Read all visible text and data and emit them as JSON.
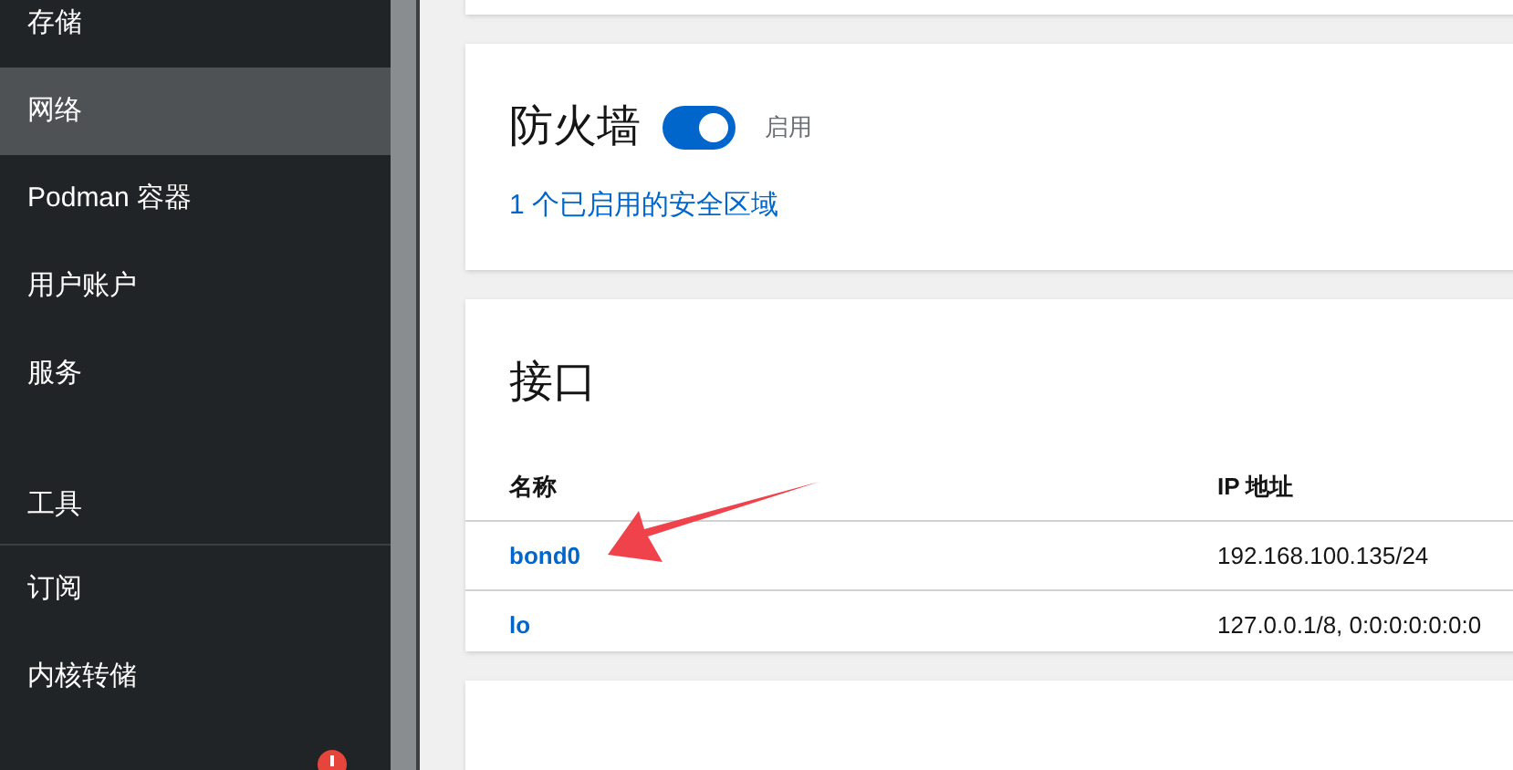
{
  "sidebar": {
    "items": [
      {
        "label": "存储",
        "selected": false,
        "kind": "item"
      },
      {
        "label": "网络",
        "selected": true,
        "kind": "item"
      },
      {
        "label": "Podman 容器",
        "selected": false,
        "kind": "item"
      },
      {
        "label": "用户账户",
        "selected": false,
        "kind": "item"
      },
      {
        "label": "服务",
        "selected": false,
        "kind": "item"
      },
      {
        "label": "工具",
        "kind": "header"
      },
      {
        "label": "订阅",
        "selected": false,
        "kind": "item"
      },
      {
        "label": "内核转储",
        "selected": false,
        "kind": "item"
      },
      {
        "selected": false,
        "kind": "item",
        "alert": true
      }
    ]
  },
  "firewall": {
    "title": "防火墙",
    "on": true,
    "status": "启用",
    "zones_link": "1 个已启用的安全区域"
  },
  "interfaces": {
    "title": "接口",
    "table": {
      "columns": [
        "名称",
        "IP 地址"
      ],
      "rows": [
        [
          "bond0",
          "192.168.100.135/24"
        ],
        [
          "lo",
          "127.0.0.1/8, 0:0:0:0:0:0:0"
        ]
      ]
    }
  }
}
